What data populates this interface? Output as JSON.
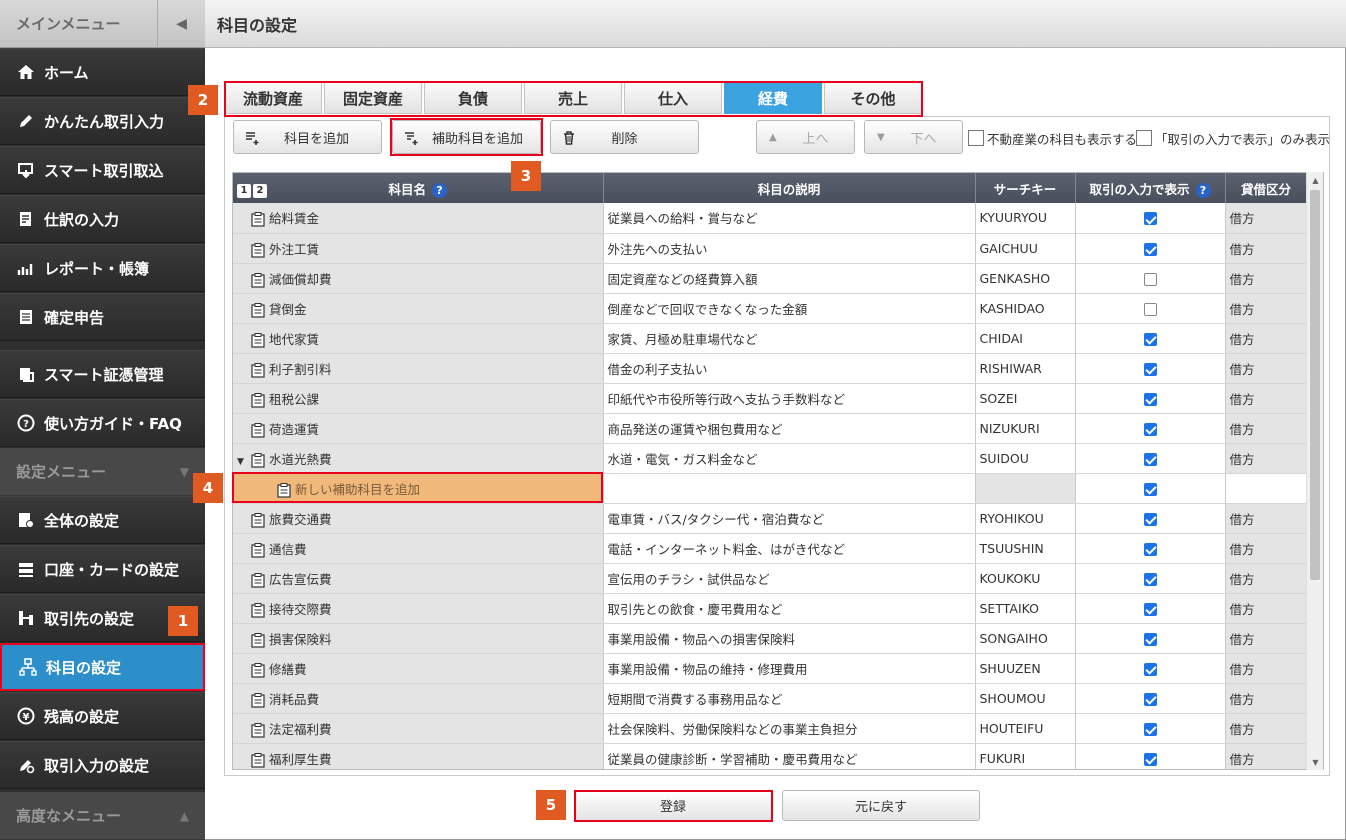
{
  "sidebar": {
    "main_menu": "メインメニュー",
    "items_main": [
      {
        "label": "ホーム",
        "icon": "home-icon"
      },
      {
        "label": "かんたん取引入力",
        "icon": "pencil-icon"
      },
      {
        "label": "スマート取引取込",
        "icon": "import-icon"
      },
      {
        "label": "仕訳の入力",
        "icon": "journal-icon"
      },
      {
        "label": "レポート・帳簿",
        "icon": "report-icon"
      },
      {
        "label": "確定申告",
        "icon": "tax-icon"
      },
      {
        "label": "スマート証憑管理",
        "icon": "receipt-icon"
      },
      {
        "label": "使い方ガイド・FAQ",
        "icon": "help-circle-icon"
      }
    ],
    "settings_menu": "設定メニュー",
    "items_settings": [
      {
        "label": "全体の設定",
        "icon": "settings-doc-icon"
      },
      {
        "label": "口座・カードの設定",
        "icon": "card-icon"
      },
      {
        "label": "取引先の設定",
        "icon": "partner-icon"
      },
      {
        "label": "科目の設定",
        "icon": "account-tree-icon"
      },
      {
        "label": "残高の設定",
        "icon": "yen-icon"
      },
      {
        "label": "取引入力の設定",
        "icon": "gear-pen-icon"
      }
    ],
    "advanced_menu": "高度なメニュー"
  },
  "header": {
    "title": "科目の設定"
  },
  "tabs": [
    {
      "label": "流動資産"
    },
    {
      "label": "固定資産"
    },
    {
      "label": "負債"
    },
    {
      "label": "売上"
    },
    {
      "label": "仕入"
    },
    {
      "label": "経費",
      "active": true
    },
    {
      "label": "その他"
    }
  ],
  "toolbar": {
    "add_account": "科目を追加",
    "add_sub_account": "補助科目を追加",
    "delete": "削除",
    "up": "上へ",
    "down": "下へ",
    "opt_realestate": "不動産業の科目も表示する",
    "opt_trade_only": "「取引の入力で表示」のみ表示"
  },
  "table": {
    "pages": [
      "1",
      "2"
    ],
    "headers": {
      "name": "科目名",
      "desc": "科目の説明",
      "key": "サーチキー",
      "show": "取引の入力で表示",
      "side": "貸借区分"
    },
    "rows": [
      {
        "name": "給料賃金",
        "desc": "従業員への給料・賞与など",
        "key": "KYUURYOU",
        "show": true,
        "side": "借方"
      },
      {
        "name": "外注工賃",
        "desc": "外注先への支払い",
        "key": "GAICHUU",
        "show": true,
        "side": "借方"
      },
      {
        "name": "減価償却費",
        "desc": "固定資産などの経費算入額",
        "key": "GENKASHO",
        "show": false,
        "side": "借方"
      },
      {
        "name": "貸倒金",
        "desc": "倒産などで回収できなくなった金額",
        "key": "KASHIDAO",
        "show": false,
        "side": "借方"
      },
      {
        "name": "地代家賃",
        "desc": "家賃、月極め駐車場代など",
        "key": "CHIDAI",
        "show": true,
        "side": "借方"
      },
      {
        "name": "利子割引料",
        "desc": "借金の利子支払い",
        "key": "RISHIWAR",
        "show": true,
        "side": "借方"
      },
      {
        "name": "租税公課",
        "desc": "印紙代や市役所等行政へ支払う手数料など",
        "key": "SOZEI",
        "show": true,
        "side": "借方"
      },
      {
        "name": "荷造運賃",
        "desc": "商品発送の運賃や梱包費用など",
        "key": "NIZUKURI",
        "show": true,
        "side": "借方"
      },
      {
        "name": "水道光熱費",
        "desc": "水道・電気・ガス料金など",
        "key": "SUIDOU",
        "show": true,
        "side": "借方",
        "expanded": true
      },
      {
        "name": "新しい補助科目を追加",
        "desc": "",
        "key": "",
        "show": true,
        "side": "",
        "sub": true
      },
      {
        "name": "旅費交通費",
        "desc": "電車賃・バス/タクシー代・宿泊費など",
        "key": "RYOHIKOU",
        "show": true,
        "side": "借方"
      },
      {
        "name": "通信費",
        "desc": "電話・インターネット料金、はがき代など",
        "key": "TSUUSHIN",
        "show": true,
        "side": "借方"
      },
      {
        "name": "広告宣伝費",
        "desc": "宣伝用のチラシ・試供品など",
        "key": "KOUKOKU",
        "show": true,
        "side": "借方"
      },
      {
        "name": "接待交際費",
        "desc": "取引先との飲食・慶弔費用など",
        "key": "SETTAIKO",
        "show": true,
        "side": "借方"
      },
      {
        "name": "損害保険料",
        "desc": "事業用設備・物品への損害保険料",
        "key": "SONGAIHO",
        "show": true,
        "side": "借方"
      },
      {
        "name": "修繕費",
        "desc": "事業用設備・物品の維持・修理費用",
        "key": "SHUUZEN",
        "show": true,
        "side": "借方"
      },
      {
        "name": "消耗品費",
        "desc": "短期間で消費する事務用品など",
        "key": "SHOUMOU",
        "show": true,
        "side": "借方"
      },
      {
        "name": "法定福利費",
        "desc": "社会保険料、労働保険料などの事業主負担分",
        "key": "HOUTEIFU",
        "show": true,
        "side": "借方"
      },
      {
        "name": "福利厚生費",
        "desc": "従業員の健康診断・学習補助・慶弔費用など",
        "key": "FUKURI",
        "show": true,
        "side": "借方"
      }
    ]
  },
  "footer": {
    "register": "登録",
    "revert": "元に戻す"
  },
  "annotations": [
    "1",
    "2",
    "3",
    "4",
    "5"
  ],
  "colors": {
    "accent": "#2c8fc9",
    "tab_active": "#3aa3e0",
    "highlight": "#e8001c",
    "badge": "#e05a22",
    "sub_row": "#f0b87a"
  }
}
